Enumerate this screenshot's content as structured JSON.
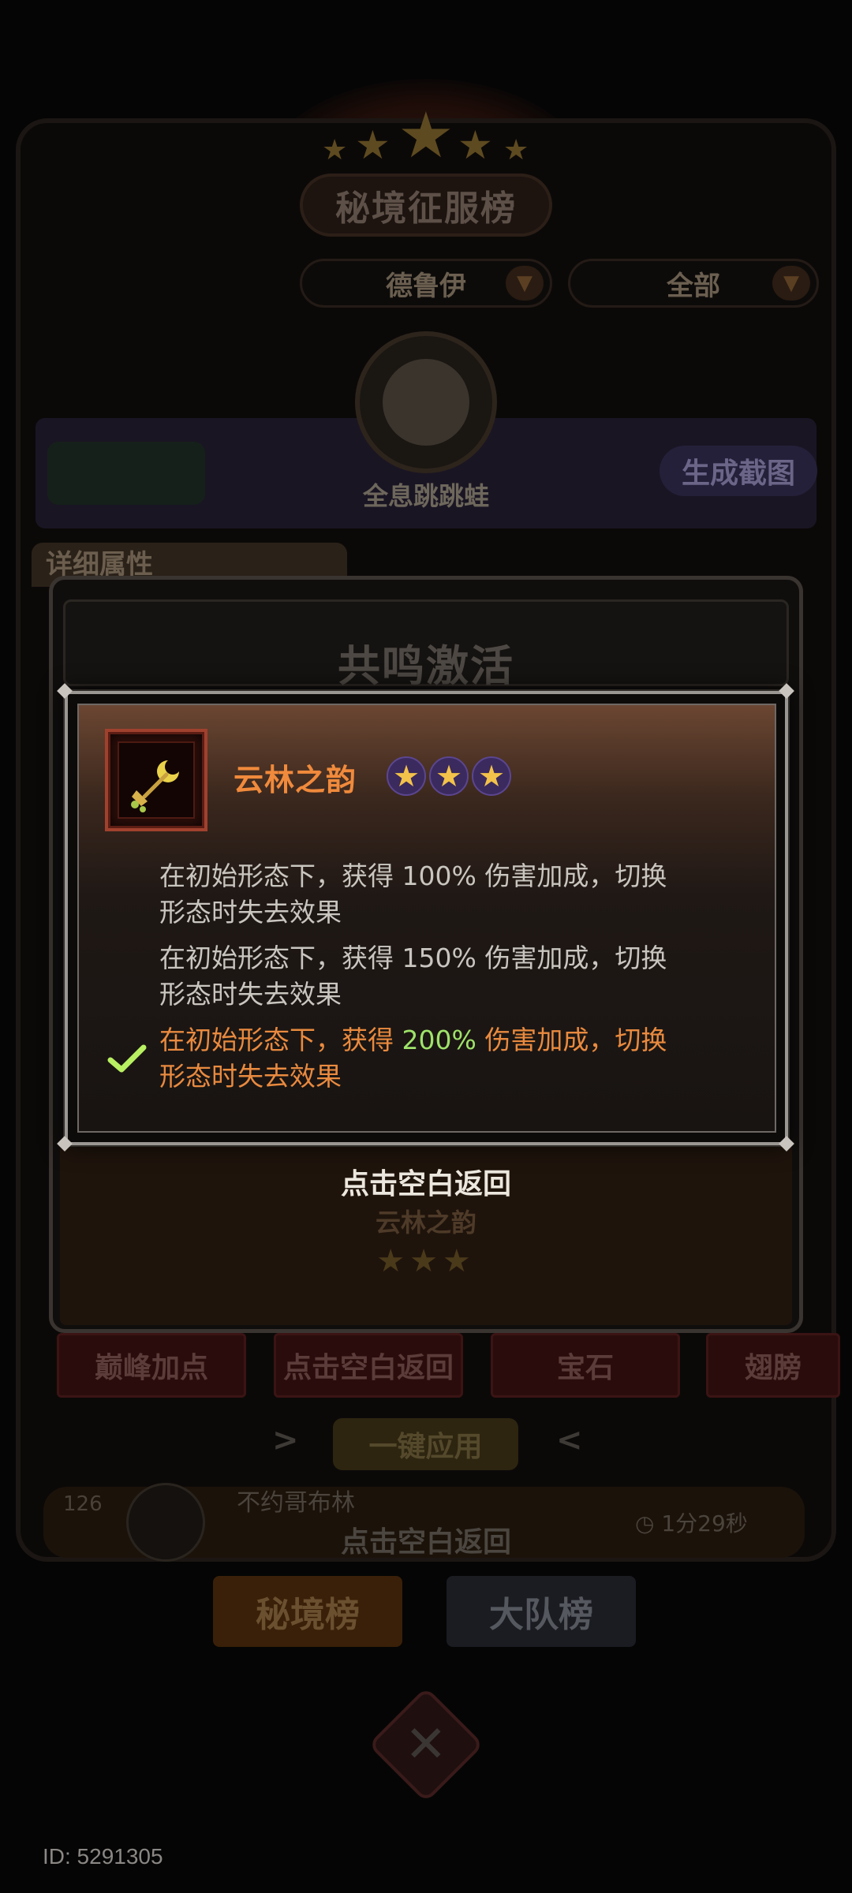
{
  "background": {
    "page_title": "秘境征服榜",
    "filter_class": "德鲁伊",
    "filter_scope": "全部",
    "player_name": "全息跳跳蛙",
    "screenshot_button": "生成截图",
    "detail_tab": "详细属性",
    "panel_title": "共鸣激活",
    "item_name": "云林之韵",
    "tabs": [
      "巅峰加点",
      "点击空白返回",
      "宝石",
      "翅膀"
    ],
    "apply_button": "一键应用",
    "rank_row": {
      "rank": "126",
      "name": "不约哥布林",
      "time": "1分29秒"
    },
    "return_hint": "点击空白返回",
    "board_tabs": [
      "秘境榜",
      "大队榜"
    ],
    "id_label": "ID: 5291305"
  },
  "dialog": {
    "item_title": "云林之韵",
    "star_count": 3,
    "effects": [
      {
        "pre": "在初始形态下，获得 ",
        "value": "100%",
        "post": " 伤害加成，切换",
        "line2": "形态时失去效果",
        "active": false
      },
      {
        "pre": "在初始形态下，获得 ",
        "value": "150%",
        "post": " 伤害加成，切换",
        "line2": "形态时失去效果",
        "active": false
      },
      {
        "pre": "在初始形态下，获得 ",
        "value": "200%",
        "post": " 伤害加成，切换",
        "line2": "形态时失去效果",
        "active": true
      }
    ],
    "return_hint": "点击空白返回"
  },
  "colors": {
    "title_orange": "#f08a3c",
    "active_text": "#e98a3f",
    "highlight_green": "#9fe36a",
    "check_green": "#b8f062"
  }
}
